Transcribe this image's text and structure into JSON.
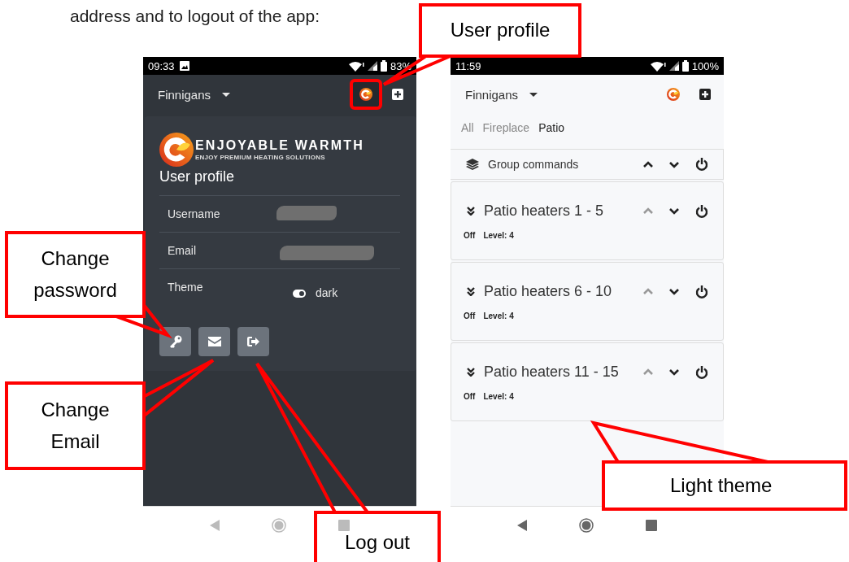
{
  "intro_text": "address and to logout of the app:",
  "phones": [
    {
      "dark": true,
      "kind": "profile",
      "status": {
        "time": "09:33",
        "battery": "83%",
        "image_notice": true
      },
      "header": {
        "account": "Finnigans",
        "profile_highlighted": true
      },
      "profile": {
        "brand": "ENJOYABLE WARMTH",
        "tagline": "ENJOY PREMIUM HEATING SOLUTIONS",
        "title": "User profile",
        "fields": [
          {
            "label": "Username",
            "kind": "redacted"
          },
          {
            "label": "Email",
            "kind": "redacted"
          },
          {
            "label": "Theme",
            "kind": "toggle",
            "on": true,
            "value": "dark"
          }
        ],
        "actions": [
          {
            "kind": "key"
          },
          {
            "kind": "mail"
          },
          {
            "kind": "logout"
          }
        ]
      }
    },
    {
      "dark": false,
      "kind": "groups",
      "status": {
        "time": "11:59",
        "battery": "100%",
        "image_notice": false
      },
      "header": {
        "account": "Finnigans",
        "profile_highlighted": false
      },
      "tabs": [
        {
          "label": "All",
          "selected": false
        },
        {
          "label": "Fireplace",
          "selected": false
        },
        {
          "label": "Patio",
          "selected": true
        }
      ],
      "group_commands": {
        "label": "Group commands",
        "can_raise": true
      },
      "groups": [
        {
          "name": "Patio heaters 1 - 5",
          "state": "Off",
          "level_text": "Level: 4",
          "can_raise": false
        },
        {
          "name": "Patio heaters 6 - 10",
          "state": "Off",
          "level_text": "Level: 4",
          "can_raise": false
        },
        {
          "name": "Patio heaters 11 - 15",
          "state": "Off",
          "level_text": "Level: 4",
          "can_raise": false
        }
      ]
    }
  ],
  "callouts": [
    {
      "text": "User profile"
    },
    {
      "text": "Change password"
    },
    {
      "text": "Change Email"
    },
    {
      "text": "Log out"
    },
    {
      "text": "Light theme"
    }
  ]
}
